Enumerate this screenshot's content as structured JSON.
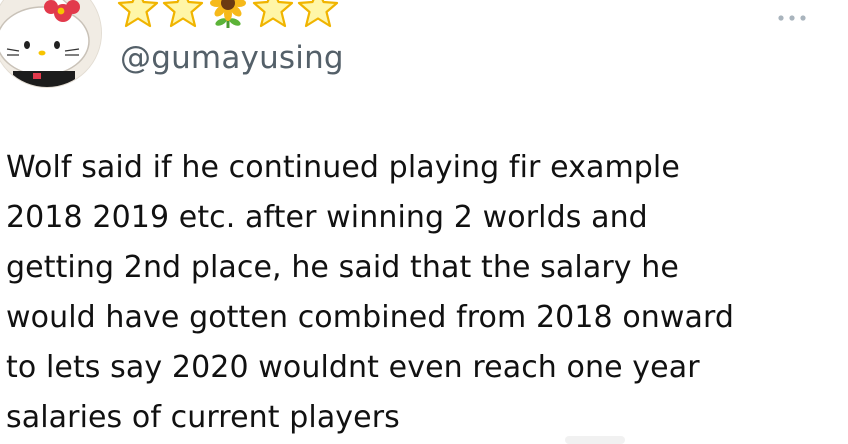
{
  "post": {
    "author": {
      "display_name_emojis": [
        "star",
        "star",
        "sunflower",
        "star",
        "star"
      ],
      "handle": "@gumayusing",
      "avatar": "hello-kitty-avatar"
    },
    "more_icon": "more-horizontal-icon",
    "text": "Wolf said if he continued playing fir example\n2018 2019 etc. after winning 2 worlds and\ngetting 2nd place, he said that the salary he\nwould have gotten combined from 2018 onward\nto lets say 2020 wouldnt even reach one year\nsalaries of current players"
  },
  "colors": {
    "handle": "#546069",
    "text": "#111111",
    "star_fill": "#fff6a8",
    "star_stroke": "#f0b400",
    "sunflower_petal": "#f6b91a",
    "sunflower_center": "#6b3a12"
  }
}
